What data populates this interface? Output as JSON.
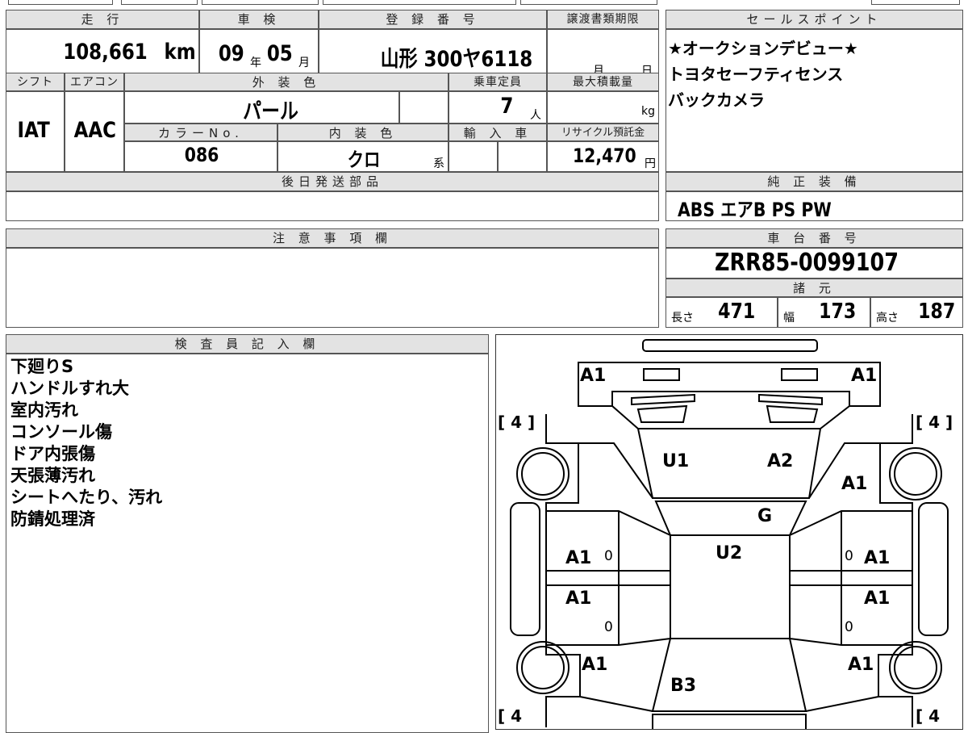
{
  "vehicle": {
    "headers": {
      "mileage": "走 行",
      "inspection": "車 検",
      "registration": "登 録 番 号",
      "transfer_deadline": "譲渡書類期限",
      "sales_points": "セールスポイント",
      "shift": "シフト",
      "aircon": "エアコン",
      "exterior_color": "外 装 色",
      "capacity": "乗車定員",
      "max_load": "最大積載量",
      "color_no": "カラーNo.",
      "interior_color": "内 装 色",
      "import": "輸 入 車",
      "recycle": "リサイクル預託金",
      "later_parts": "後日発送部品",
      "genuine_equipment": "純 正 装 備",
      "notes": "注 意 事 項 欄",
      "chassis_no": "車 台 番 号",
      "specs": "諸 元",
      "inspector": "検 査 員 記 入 欄"
    },
    "mileage": "108,661",
    "mileage_unit": "km",
    "inspection_year": "09",
    "year_unit": "年",
    "inspection_month": "05",
    "month_unit": "月",
    "registration": "山形 300ヤ6118",
    "deadline_month_unit": "月",
    "deadline_day_unit": "日",
    "shift": "IAT",
    "aircon": "AAC",
    "exterior_color": "パール",
    "capacity": "7",
    "capacity_unit": "人",
    "max_load_unit": "kg",
    "color_no": "086",
    "interior_color": "クロ",
    "interior_suffix": "系",
    "recycle_fee": "12,470",
    "recycle_unit": "円",
    "sales_points": [
      "★オークションデビュー★",
      "トヨタセーフティセンス",
      "バックカメラ"
    ],
    "equipment": "ABS エアB PS PW",
    "chassis_no": "ZRR85-0099107",
    "specs": {
      "length_label": "長さ",
      "length": "471",
      "width_label": "幅",
      "width": "173",
      "height_label": "高さ",
      "height": "187"
    },
    "inspector_notes": [
      "下廻りS",
      "ハンドルすれ大",
      "室内汚れ",
      "コンソール傷",
      "ドア内張傷",
      "天張薄汚れ",
      "シートへたり、汚れ",
      "防錆処理済"
    ]
  },
  "diagram": {
    "tire_left_top": "[ 4 ]",
    "tire_right_top": "[ 4 ]",
    "tire_left_bottom": "[ 4",
    "tire_right_bottom": "[ 4",
    "marks": {
      "front_left": "A1",
      "front_right": "A1",
      "hood_left": "U1",
      "hood_right": "A2",
      "right_fender": "A1",
      "windshield": "G",
      "roof": "U2",
      "left_front_door": "A1",
      "right_front_door": "A1",
      "left_rear_door": "A1",
      "right_rear_door": "A1",
      "left_rear_quarter": "A1",
      "right_rear_quarter": "A1",
      "back_door": "B3",
      "zero": "0"
    }
  }
}
